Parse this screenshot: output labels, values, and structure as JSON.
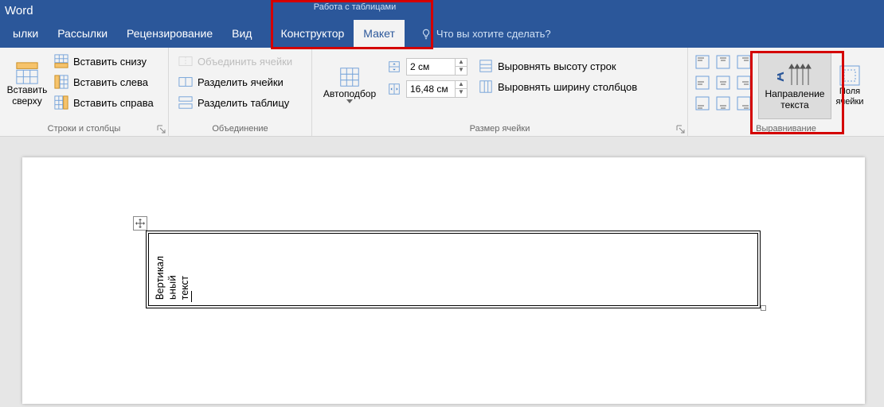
{
  "app": {
    "name": "Word"
  },
  "context_tab_group": {
    "title": "Работа с таблицами"
  },
  "tabs": {
    "t0": "ылки",
    "t1": "Рассылки",
    "t2": "Рецензирование",
    "t3": "Вид",
    "t4": "Конструктор",
    "t5": "Макет"
  },
  "tell_me": {
    "placeholder": "Что вы хотите сделать?"
  },
  "ribbon": {
    "rows_cols": {
      "insert_above": "Вставить\nсверху",
      "insert_below": "Вставить снизу",
      "insert_left": "Вставить слева",
      "insert_right": "Вставить справа",
      "label": "Строки и столбцы"
    },
    "merge": {
      "merge_cells": "Объединить ячейки",
      "split_cells": "Разделить ячейки",
      "split_table": "Разделить таблицу",
      "label": "Объединение"
    },
    "cell_size": {
      "autofit": "Автоподбор",
      "height": "2 см",
      "width": "16,48 см",
      "dist_rows": "Выровнять высоту строк",
      "dist_cols": "Выровнять ширину столбцов",
      "label": "Размер ячейки"
    },
    "alignment": {
      "text_direction": "Направление\nтекста",
      "cell_margins": "Поля\nячейки",
      "label": "Выравнивание"
    }
  },
  "document": {
    "cell_text": "Вертикал\nьный\nтекст"
  }
}
